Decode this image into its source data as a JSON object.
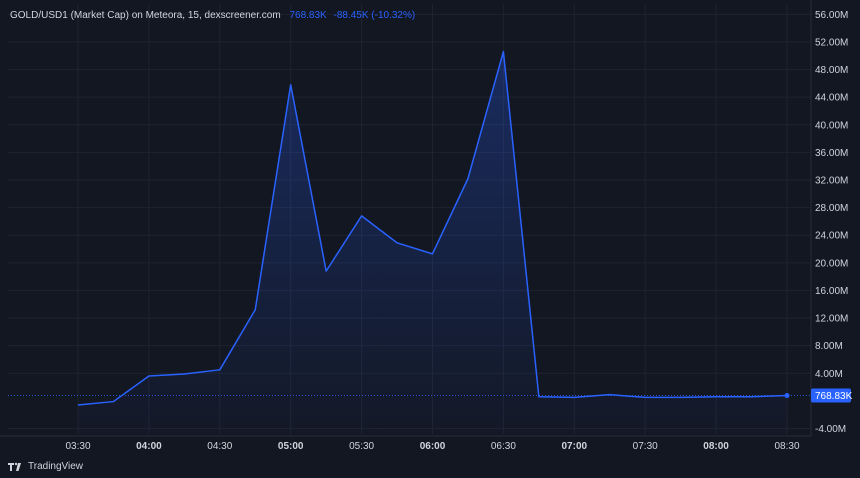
{
  "header": {
    "title": "GOLD/USD1 (Market Cap) on Meteora, 15, dexscreener.com",
    "last_value": "768.83K",
    "change": "-88.45K (-10.32%)"
  },
  "brand": {
    "name": "TradingView",
    "icon": "tradingview-logo-icon"
  },
  "colors": {
    "background": "#131722",
    "line": "#2962ff",
    "grid": "#1f2330",
    "text": "#d1d4dc"
  },
  "price_tag": "768.83K",
  "chart_data": {
    "type": "area",
    "x": [
      "03:30",
      "03:45",
      "04:00",
      "04:15",
      "04:30",
      "04:45",
      "05:00",
      "05:15",
      "05:30",
      "05:45",
      "06:00",
      "06:15",
      "06:30",
      "06:45",
      "07:00",
      "07:15",
      "07:30",
      "07:45",
      "08:00",
      "08:15",
      "08:30"
    ],
    "series": [
      {
        "values": [
          -0.6,
          -0.1,
          3.6,
          3.9,
          4.5,
          13.2,
          45.8,
          18.8,
          26.8,
          22.9,
          21.3,
          32.2,
          50.6,
          0.6,
          0.5,
          0.9,
          0.5,
          0.5,
          0.6,
          0.6,
          0.77
        ]
      }
    ],
    "x_ticks": [
      "03:30",
      "04:00",
      "04:30",
      "05:00",
      "05:30",
      "06:00",
      "06:30",
      "07:00",
      "07:30",
      "08:00",
      "08:30"
    ],
    "x_ticks_bold": [
      "04:00",
      "05:00",
      "06:00",
      "07:00",
      "08:00"
    ],
    "y_ticks": [
      -4,
      4,
      8,
      12,
      16,
      20,
      24,
      28,
      32,
      36,
      40,
      44,
      48,
      52,
      56
    ],
    "y_tick_labels": [
      "-4.00M",
      "4.00M",
      "8.00M",
      "12.00M",
      "16.00M",
      "20.00M",
      "24.00M",
      "28.00M",
      "32.00M",
      "36.00M",
      "40.00M",
      "44.00M",
      "48.00M",
      "52.00M",
      "56.00M"
    ],
    "ylim": [
      -4.8,
      57.5
    ],
    "last_value": 0.77,
    "grid": true
  }
}
